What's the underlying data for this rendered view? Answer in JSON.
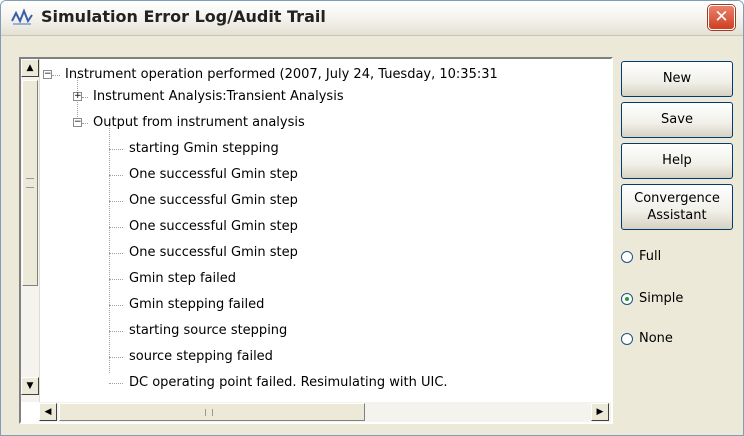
{
  "window": {
    "title": "Simulation Error Log/Audit Trail",
    "close_glyph": "✕"
  },
  "tree": {
    "root": "Instrument operation performed  (2007, July 24, Tuesday, 10:35:31",
    "child_collapsed": "Instrument Analysis:Transient Analysis",
    "child_expanded": "Output from instrument analysis",
    "log_lines": [
      "starting Gmin stepping",
      "One successful Gmin step",
      "One successful Gmin step",
      "One successful Gmin step",
      "One successful Gmin step",
      "Gmin step failed",
      "Gmin stepping failed",
      "starting source stepping",
      "source stepping failed",
      "DC operating point failed. Resimulating with UIC."
    ]
  },
  "buttons": {
    "new_label": "New",
    "save_label": "Save",
    "help_label": "Help",
    "convergence_line1": "Convergence",
    "convergence_line2": "Assistant"
  },
  "detail_level": {
    "options": [
      "Full",
      "Simple",
      "None"
    ],
    "selected": "Simple"
  },
  "icons": {
    "app": "simulation-wave-icon",
    "close": "close-icon",
    "scroll_up": "arrow-up-icon",
    "scroll_down": "arrow-down-icon",
    "scroll_left": "arrow-left-icon",
    "scroll_right": "arrow-right-icon"
  }
}
